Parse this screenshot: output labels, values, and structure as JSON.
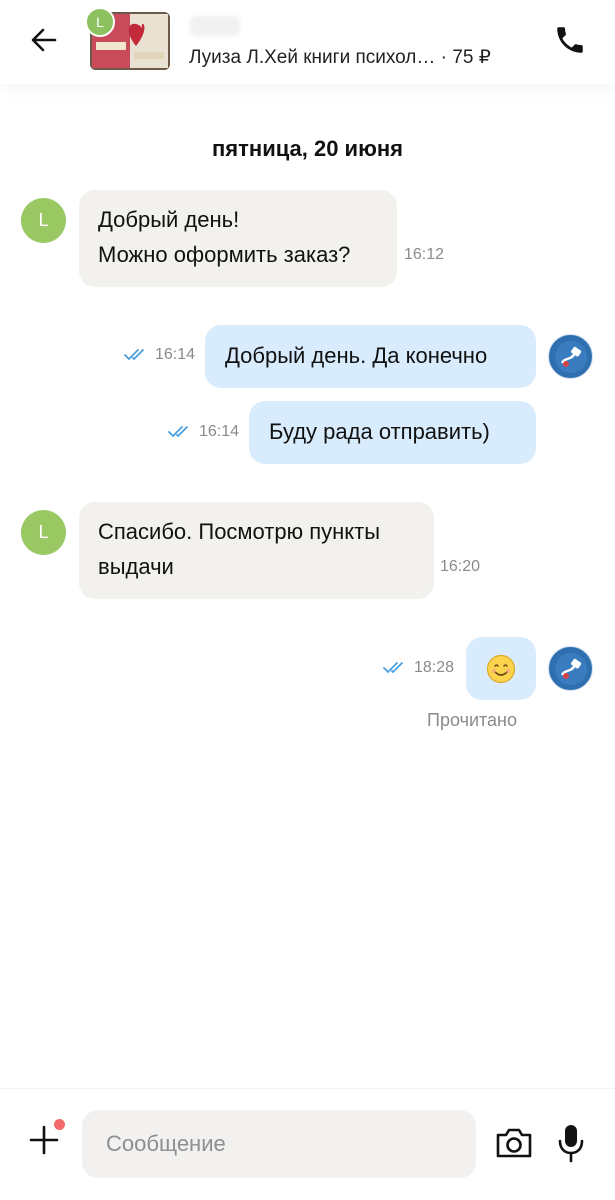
{
  "header": {
    "listing_title": "Луиза Л.Хей книги психол… · 75 ₽",
    "seller_initial": "L",
    "back_icon": "arrow-left-icon",
    "call_icon": "phone-icon"
  },
  "chat": {
    "date_separator": "пятница, 20 июня",
    "messages": [
      {
        "direction": "in",
        "lines": [
          "Добрый день!",
          "Можно оформить заказ?"
        ],
        "time": "16:12",
        "avatar": "L"
      },
      {
        "direction": "out",
        "lines": [
          "Добрый день. Да конечно"
        ],
        "time": "16:14",
        "status": "read"
      },
      {
        "direction": "out",
        "lines": [
          "Буду рада отправить)"
        ],
        "time": "16:14",
        "status": "read"
      },
      {
        "direction": "in",
        "lines": [
          "Спасибо. Посмотрю пункты",
          "выдачи"
        ],
        "time": "16:20",
        "avatar": "L"
      },
      {
        "direction": "out",
        "lines": [
          "😊"
        ],
        "time": "18:28",
        "status": "read"
      }
    ],
    "read_label": "Прочитано"
  },
  "input_bar": {
    "placeholder": "Сообщение",
    "plus_icon": "plus-icon",
    "camera_icon": "camera-icon",
    "mic_icon": "microphone-icon"
  },
  "colors": {
    "incoming_bubble": "#f2f1ed",
    "outgoing_bubble": "#d8ecfd",
    "read_check": "#4a9fe0",
    "seller_avatar": "#9ac863",
    "notification_dot": "#f36a6a"
  }
}
